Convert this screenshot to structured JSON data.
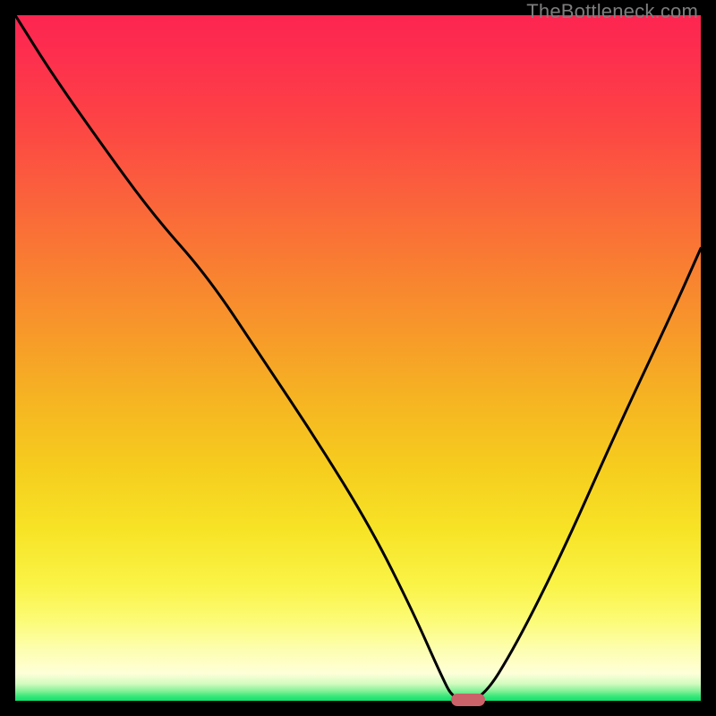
{
  "watermark": "TheBottleneck.com",
  "chart_data": {
    "type": "line",
    "title": "",
    "xlabel": "",
    "ylabel": "",
    "xlim": [
      0,
      100
    ],
    "ylim": [
      0,
      100
    ],
    "grid": false,
    "legend": false,
    "annotations": [
      "TheBottleneck.com"
    ],
    "series": [
      {
        "name": "bottleneck-curve",
        "x": [
          0,
          5,
          12,
          20,
          28,
          36,
          44,
          52,
          58,
          62,
          64,
          68,
          73,
          80,
          88,
          96,
          100
        ],
        "values": [
          100,
          92,
          82,
          71,
          62,
          50,
          38,
          25,
          13,
          4,
          0,
          0,
          8,
          22,
          40,
          57,
          66
        ]
      }
    ],
    "marker": {
      "x": 66,
      "y": 0
    }
  },
  "colors": {
    "curve": "#000000",
    "marker": "#cb6169",
    "frame": "#000000"
  }
}
